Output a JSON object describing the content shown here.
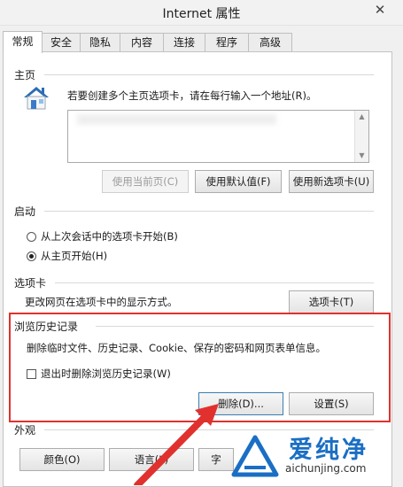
{
  "window": {
    "title": "Internet 属性",
    "close_glyph": "✕"
  },
  "tabs": [
    {
      "label": "常规",
      "active": true
    },
    {
      "label": "安全"
    },
    {
      "label": "隐私"
    },
    {
      "label": "内容"
    },
    {
      "label": "连接"
    },
    {
      "label": "程序"
    },
    {
      "label": "高级"
    }
  ],
  "home": {
    "title": "主页",
    "description": "若要创建多个主页选项卡，请在每行输入一个地址(R)。",
    "buttons": {
      "use_current": "使用当前页(C)",
      "use_default": "使用默认值(F)",
      "use_new_tab": "使用新选项卡(U)"
    }
  },
  "startup": {
    "title": "启动",
    "options": [
      {
        "label": "从上次会话中的选项卡开始(B)",
        "checked": false
      },
      {
        "label": "从主页开始(H)",
        "checked": true
      }
    ]
  },
  "tabs_section": {
    "title": "选项卡",
    "description": "更改网页在选项卡中的显示方式。",
    "button": "选项卡(T)"
  },
  "history": {
    "title": "浏览历史记录",
    "description": "删除临时文件、历史记录、Cookie、保存的密码和网页表单信息。",
    "checkbox": "退出时删除浏览历史记录(W)",
    "checkbox_checked": false,
    "delete_button": "删除(D)...",
    "settings_button": "设置(S)"
  },
  "appearance": {
    "title": "外观",
    "buttons": [
      "颜色(O)",
      "语言(L)",
      "字"
    ]
  },
  "annotation": {
    "highlight_color": "#e0312e",
    "arrow_color": "#e0312e"
  },
  "watermark": {
    "brand_text": "爱纯净",
    "url": "aichunjing.com",
    "brand_color": "#1a6fc4"
  }
}
